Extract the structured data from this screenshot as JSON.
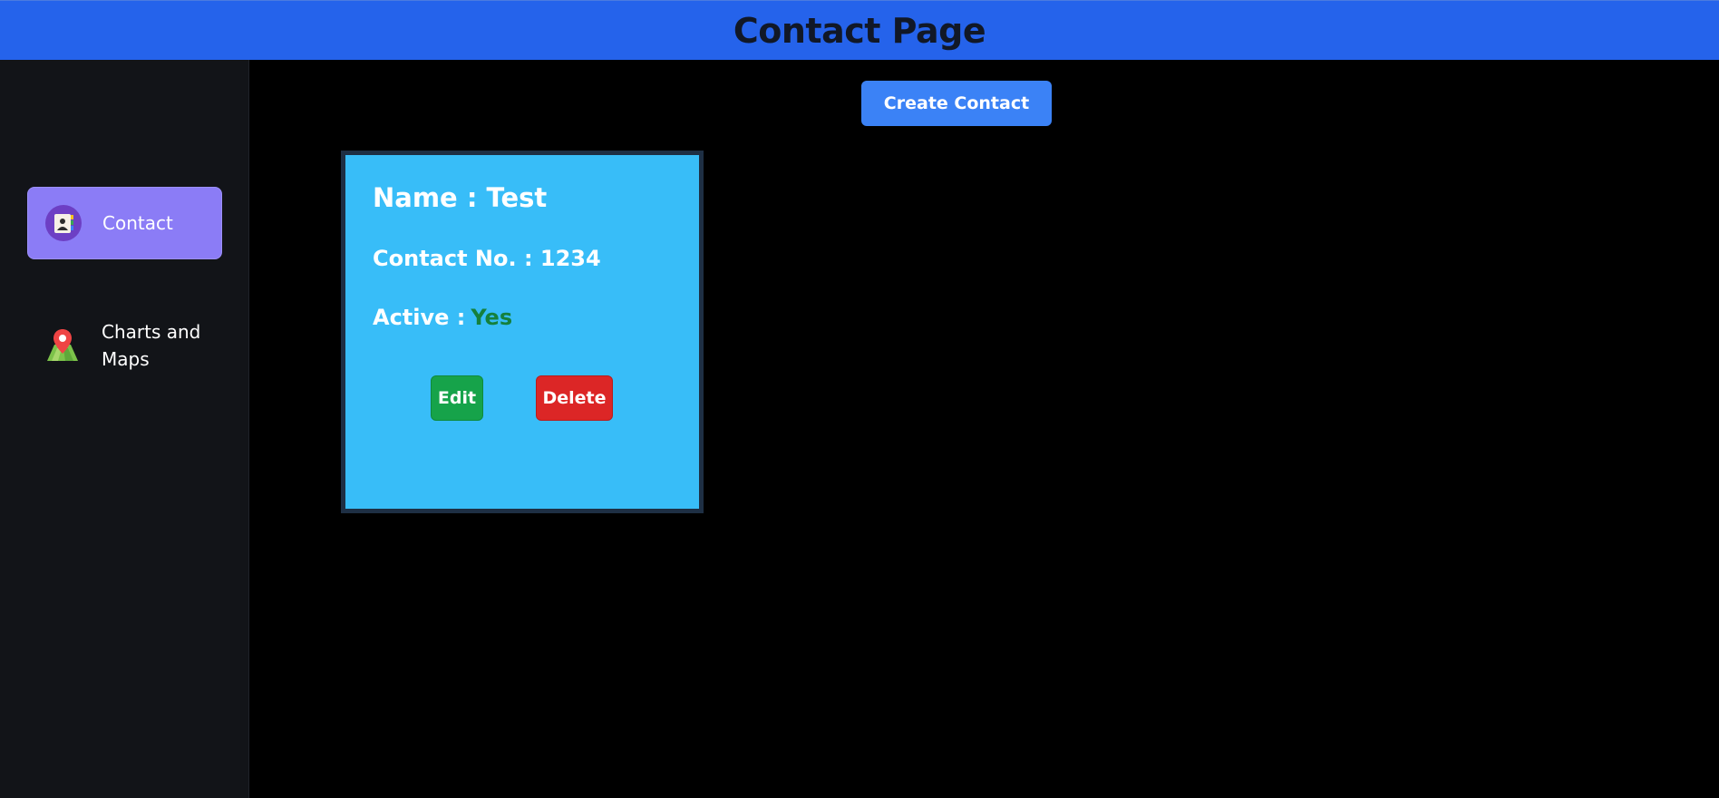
{
  "header": {
    "title": "Contact Page"
  },
  "sidebar": {
    "items": [
      {
        "label": "Contact",
        "icon": "contact-book-icon",
        "active": true
      },
      {
        "label": "Charts and Maps",
        "icon": "map-pin-icon",
        "active": false
      }
    ]
  },
  "main": {
    "create_label": "Create Contact",
    "contacts": [
      {
        "name_label": "Name : Test",
        "contact_label": "Contact No. : 1234",
        "active_label": "Active :",
        "active_value": "Yes",
        "edit_label": "Edit",
        "delete_label": "Delete"
      }
    ]
  },
  "colors": {
    "header_bg": "#2563eb",
    "sidebar_bg": "#121418",
    "active_nav_bg": "#8b7cf6",
    "card_bg": "#38bdf8",
    "create_button": "#3b82f6",
    "edit_button": "#16a34a",
    "delete_button": "#dc2626",
    "active_yes": "#15803d"
  }
}
